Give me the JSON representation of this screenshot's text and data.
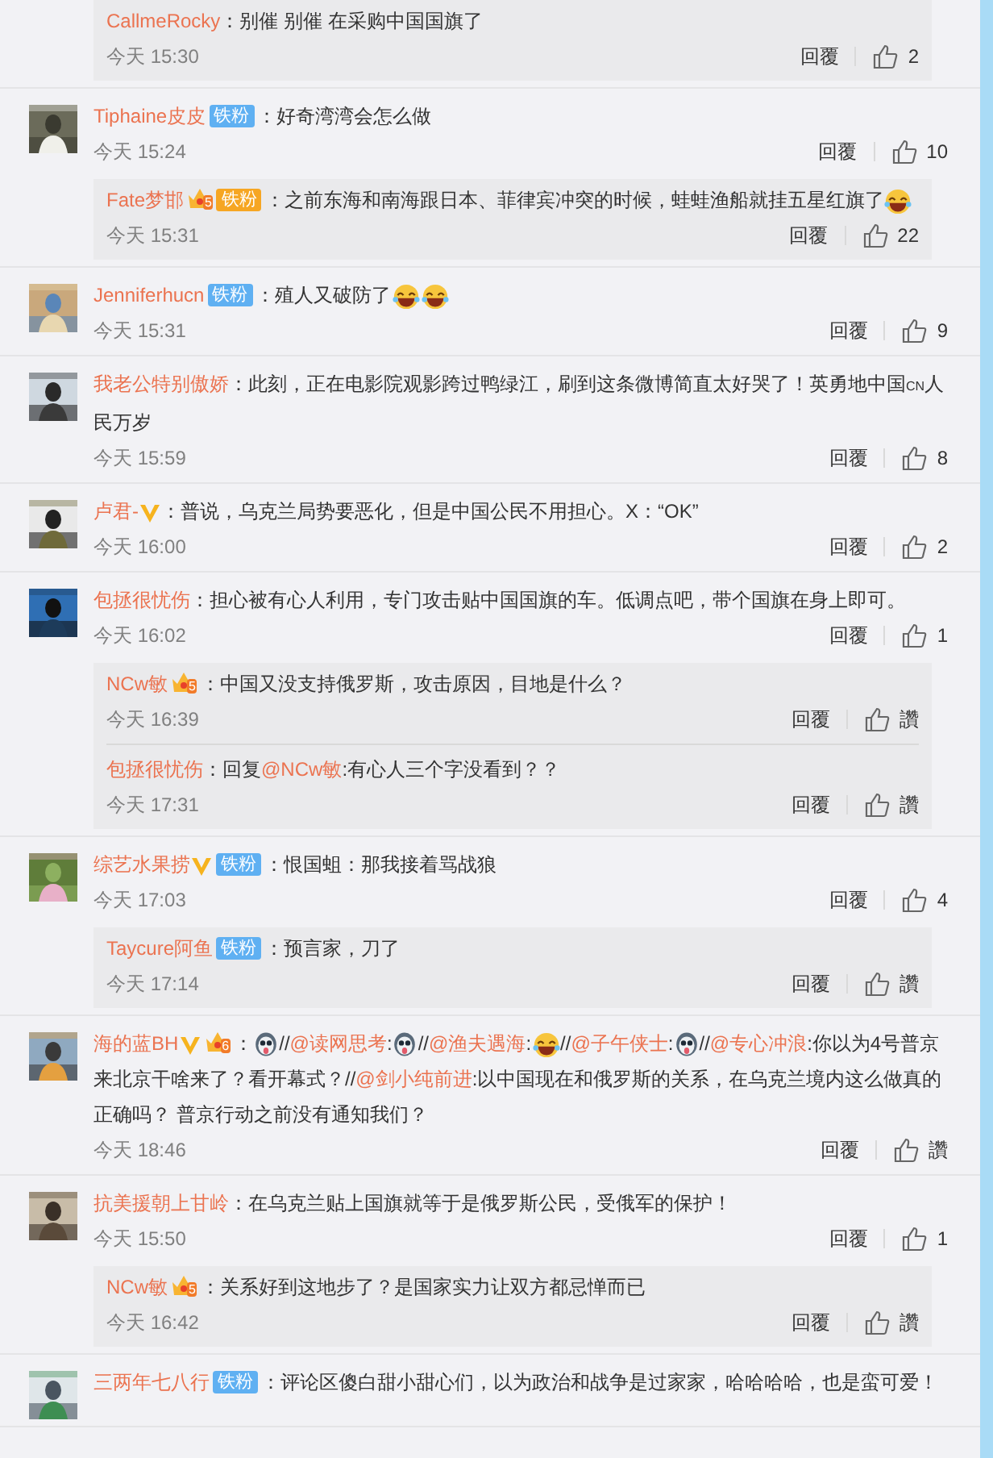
{
  "comments": [
    {
      "replies": [
        {
          "user": "CallmeRocky",
          "content": [
            {
              "kind": "text",
              "text": "：别催 别催 在采购中国国旗了"
            }
          ],
          "time": "今天 15:30",
          "reply": "回覆",
          "likes": "2"
        }
      ]
    },
    {
      "user": "Tiphaine皮皮",
      "badges": [
        {
          "kind": "fan",
          "text": "铁粉"
        }
      ],
      "content": [
        {
          "kind": "text",
          "text": "：好奇湾湾会怎么做"
        }
      ],
      "time": "今天 15:24",
      "reply": "回覆",
      "likes": "10",
      "replies": [
        {
          "user": "Fate梦邯",
          "badges": [
            {
              "kind": "vip",
              "text": "5"
            },
            {
              "kind": "gold-fan",
              "text": "铁粉"
            }
          ],
          "content": [
            {
              "kind": "text",
              "text": "：之前东海和南海跟日本、菲律宾冲突的时候，蛙蛙渔船就挂五星红旗了"
            },
            {
              "kind": "laugh"
            }
          ],
          "time": "今天 15:31",
          "reply": "回覆",
          "likes": "22"
        }
      ]
    },
    {
      "user": "Jenniferhucn",
      "badges": [
        {
          "kind": "fan",
          "text": "铁粉"
        }
      ],
      "content": [
        {
          "kind": "text",
          "text": "：殖人又破防了"
        },
        {
          "kind": "laugh"
        },
        {
          "kind": "laugh"
        }
      ],
      "time": "今天 15:31",
      "reply": "回覆",
      "likes": "9"
    },
    {
      "user": "我老公特别傲娇",
      "content": [
        {
          "kind": "text",
          "text": "：此刻，正在电影院观影跨过鸭绿江，刷到这条微博简直太好哭了！英勇地中国"
        },
        {
          "kind": "small",
          "text": "CN"
        },
        {
          "kind": "text",
          "text": "人民万岁"
        }
      ],
      "time": "今天 15:59",
      "reply": "回覆",
      "likes": "8"
    },
    {
      "user": "卢君-",
      "badges": [
        {
          "kind": "verified"
        }
      ],
      "content": [
        {
          "kind": "text",
          "text": "：普说，乌克兰局势要恶化，但是中国公民不用担心。X：“OK”"
        }
      ],
      "time": "今天 16:00",
      "reply": "回覆",
      "likes": "2"
    },
    {
      "user": "包拯很忧伤",
      "content": [
        {
          "kind": "text",
          "text": "：担心被有心人利用，专门攻击贴中国国旗的车。低调点吧，带个国旗在身上即可。"
        }
      ],
      "time": "今天 16:02",
      "reply": "回覆",
      "likes": "1",
      "replies": [
        {
          "user": "NCw敏",
          "badges": [
            {
              "kind": "vip",
              "text": "5"
            }
          ],
          "content": [
            {
              "kind": "text",
              "text": "：中国又没支持俄罗斯，攻击原因，目地是什么？"
            }
          ],
          "time": "今天 16:39",
          "reply": "回覆",
          "likes": "讚"
        },
        {
          "user": "包拯很忧伤",
          "content": [
            {
              "kind": "text",
              "text": "：回复"
            },
            {
              "kind": "mention",
              "text": "@NCw敏"
            },
            {
              "kind": "text",
              "text": ":有心人三个字没看到？？"
            }
          ],
          "time": "今天 17:31",
          "reply": "回覆",
          "likes": "讚"
        }
      ]
    },
    {
      "user": "综艺水果捞",
      "badges": [
        {
          "kind": "verified"
        },
        {
          "kind": "fan",
          "text": "铁粉"
        }
      ],
      "content": [
        {
          "kind": "text",
          "text": "：恨国蛆：那我接着骂战狼"
        }
      ],
      "time": "今天 17:03",
      "reply": "回覆",
      "likes": "4",
      "replies": [
        {
          "user": "Taycure阿鱼",
          "badges": [
            {
              "kind": "fan",
              "text": "铁粉"
            }
          ],
          "content": [
            {
              "kind": "text",
              "text": "：预言家，刀了"
            }
          ],
          "time": "今天 17:14",
          "reply": "回覆",
          "likes": "讚"
        }
      ]
    },
    {
      "user": "海的蓝BH",
      "badges": [
        {
          "kind": "verified"
        },
        {
          "kind": "vip",
          "text": "6"
        }
      ],
      "content": [
        {
          "kind": "text",
          "text": "："
        },
        {
          "kind": "dog"
        },
        {
          "kind": "text",
          "text": "//"
        },
        {
          "kind": "mention",
          "text": "@读网思考"
        },
        {
          "kind": "text",
          "text": ":"
        },
        {
          "kind": "dog"
        },
        {
          "kind": "text",
          "text": "//"
        },
        {
          "kind": "mention",
          "text": "@渔夫遇海"
        },
        {
          "kind": "text",
          "text": ":"
        },
        {
          "kind": "laugh"
        },
        {
          "kind": "text",
          "text": "//"
        },
        {
          "kind": "mention",
          "text": "@子午侠士"
        },
        {
          "kind": "text",
          "text": ":"
        },
        {
          "kind": "dog"
        },
        {
          "kind": "text",
          "text": "//"
        },
        {
          "kind": "mention",
          "text": "@专心冲浪"
        },
        {
          "kind": "text",
          "text": ":你以为4号普京来北京干啥来了？看开幕式？//"
        },
        {
          "kind": "mention",
          "text": "@剑小纯前进"
        },
        {
          "kind": "text",
          "text": ":以中国现在和俄罗斯的关系，在乌克兰境内这么做真的正确吗？ 普京行动之前没有通知我们？"
        }
      ],
      "time": "今天 18:46",
      "reply": "回覆",
      "likes": "讚"
    },
    {
      "user": "抗美援朝上甘岭",
      "content": [
        {
          "kind": "text",
          "text": "：在乌克兰贴上国旗就等于是俄罗斯公民，受俄军的保护！"
        }
      ],
      "time": "今天 15:50",
      "reply": "回覆",
      "likes": "1",
      "replies": [
        {
          "user": "NCw敏",
          "badges": [
            {
              "kind": "vip",
              "text": "5"
            }
          ],
          "content": [
            {
              "kind": "text",
              "text": "：关系好到这地步了？是国家实力让双方都忌惮而已"
            }
          ],
          "time": "今天 16:42",
          "reply": "回覆",
          "likes": "讚"
        }
      ]
    },
    {
      "user": "三两年七八行",
      "badges": [
        {
          "kind": "fan",
          "text": "铁粉"
        }
      ],
      "content": [
        {
          "kind": "text",
          "text": "：评论区傻白甜小甜心们，以为政治和战争是过家家，哈哈哈哈，也是蛮可爱！"
        }
      ]
    }
  ]
}
